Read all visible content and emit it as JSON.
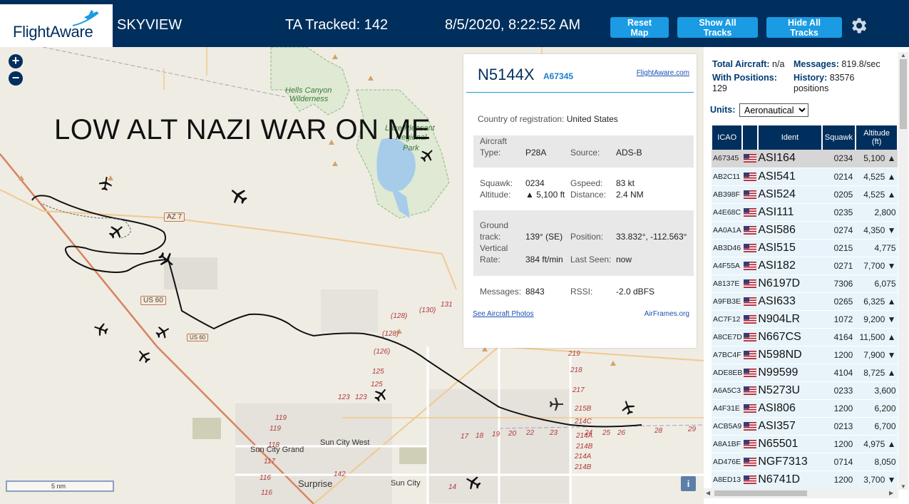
{
  "header": {
    "logo_text": "FlightAware",
    "app_name": "SKYVIEW",
    "tracked": "TA Tracked: 142",
    "datetime": "8/5/2020, 8:22:52 AM",
    "buttons": {
      "reset": "Reset Map",
      "show_all": "Show All Tracks",
      "hide_all": "Hide All Tracks"
    },
    "settings_icon": "gear-icon"
  },
  "map": {
    "zoom_in": "+",
    "zoom_out": "−",
    "overlay_text": "LOW ALT NAZI WAR ON ME",
    "labels": {
      "hells_canyon": "Hells Canyon",
      "wilderness": "Wilderness",
      "lake_pleasant_1": "Lake Pleasant",
      "lake_pleasant_2": "Regional",
      "lake_pleasant_3": "Park",
      "sun_city_grand": "Sun City Grand",
      "sun_city_west": "Sun City West",
      "surprise": "Surprise",
      "sun_city": "Sun City"
    },
    "shields": {
      "az74": "AZ 7",
      "us60": "US 60",
      "us60b": "US 60"
    },
    "road_numbers": [
      "(128)",
      "(130)",
      "131",
      "(128)",
      "(126)",
      "125",
      "125",
      "123",
      "123",
      "219",
      "218",
      "217",
      "215B",
      "214C",
      "214A",
      "214B",
      "214C",
      "214A",
      "214B",
      "119",
      "119",
      "118",
      "117",
      "116",
      "116",
      "142",
      "14",
      "17",
      "18",
      "19",
      "20",
      "22",
      "23",
      "24",
      "25",
      "26",
      "28",
      "29"
    ],
    "scale": "5 nm",
    "info_icon": "i"
  },
  "popup": {
    "registration": "N5144X",
    "icao": "A67345",
    "link": "FlightAware.com",
    "country_label": "Country of registration:",
    "country": "United States",
    "aircraft_type_label1": "Aircraft",
    "aircraft_type_label2": "Type:",
    "aircraft_type": "P28A",
    "source_label": "Source:",
    "source": "ADS-B",
    "squawk_label": "Squawk:",
    "squawk": "0234",
    "gspeed_label": "Gspeed:",
    "gspeed": "83 kt",
    "altitude_label": "Altitude:",
    "altitude": "▲ 5,100 ft",
    "distance_label": "Distance:",
    "distance": "2.4 NM",
    "ground_track_label1": "Ground",
    "ground_track_label2": "track:",
    "ground_track": "139° (SE)",
    "position_label": "Position:",
    "position": "33.832°, -112.563°",
    "vertical_rate_label1": "Vertical",
    "vertical_rate_label2": "Rate:",
    "vertical_rate": "384 ft/min",
    "last_seen_label": "Last Seen:",
    "last_seen": "now",
    "messages_label": "Messages:",
    "messages": "8843",
    "rssi_label": "RSSI:",
    "rssi": "-2.0 dBFS",
    "photos_link": "See Aircraft Photos",
    "airframes_link": "AirFrames.org"
  },
  "sidebar": {
    "total_aircraft_label": "Total Aircraft:",
    "total_aircraft": "n/a",
    "messages_label": "Messages:",
    "messages": "819.8/sec",
    "with_positions_label": "With Positions:",
    "with_positions": "129",
    "history_label": "History:",
    "history_1": "83576",
    "history_2": "positions",
    "units_label": "Units:",
    "units_value": "Aeronautical",
    "columns": {
      "icao": "ICAO",
      "ident": "Ident",
      "squawk": "Squawk",
      "alt1": "Altitude",
      "alt2": "(ft)"
    },
    "rows": [
      {
        "icao": "A67345",
        "ident": "ASI164",
        "squawk": "0234",
        "alt": "5,100 ▲",
        "sel": true
      },
      {
        "icao": "AB2C11",
        "ident": "ASI541",
        "squawk": "0214",
        "alt": "4,525 ▲"
      },
      {
        "icao": "AB398F",
        "ident": "ASI524",
        "squawk": "0205",
        "alt": "4,525 ▲"
      },
      {
        "icao": "A4E68C",
        "ident": "ASI111",
        "squawk": "0235",
        "alt": "2,800"
      },
      {
        "icao": "AA0A1A",
        "ident": "ASI586",
        "squawk": "0274",
        "alt": "4,350 ▼"
      },
      {
        "icao": "AB3D46",
        "ident": "ASI515",
        "squawk": "0215",
        "alt": "4,775"
      },
      {
        "icao": "A4F55A",
        "ident": "ASI182",
        "squawk": "0271",
        "alt": "7,700 ▼"
      },
      {
        "icao": "A8137E",
        "ident": "N6197D",
        "squawk": "7306",
        "alt": "6,075"
      },
      {
        "icao": "A9FB3E",
        "ident": "ASI633",
        "squawk": "0265",
        "alt": "6,325 ▲"
      },
      {
        "icao": "AC7F12",
        "ident": "N904LR",
        "squawk": "1072",
        "alt": "9,200 ▼"
      },
      {
        "icao": "A8CE7D",
        "ident": "N667CS",
        "squawk": "4164",
        "alt": "11,500 ▲"
      },
      {
        "icao": "A7BC4F",
        "ident": "N598ND",
        "squawk": "1200",
        "alt": "7,900 ▼"
      },
      {
        "icao": "ADE8EB",
        "ident": "N99599",
        "squawk": "4104",
        "alt": "8,725 ▲"
      },
      {
        "icao": "A6A5C3",
        "ident": "N5273U",
        "squawk": "0233",
        "alt": "3,600"
      },
      {
        "icao": "A4F31E",
        "ident": "ASI806",
        "squawk": "1200",
        "alt": "6,200"
      },
      {
        "icao": "ACB5A9",
        "ident": "ASI357",
        "squawk": "0213",
        "alt": "6,700"
      },
      {
        "icao": "A8A1BF",
        "ident": "N65501",
        "squawk": "1200",
        "alt": "4,975 ▲"
      },
      {
        "icao": "AD476E",
        "ident": "NGF7313",
        "squawk": "0714",
        "alt": "8,050"
      },
      {
        "icao": "A8ED13",
        "ident": "N6741D",
        "squawk": "1200",
        "alt": "3,700 ▼"
      }
    ]
  },
  "colors": {
    "header_bg": "#002f5d",
    "button_bg": "#1a9be3",
    "row_bg": "#e8f4fa",
    "selected_row": "#d6d6d6"
  }
}
